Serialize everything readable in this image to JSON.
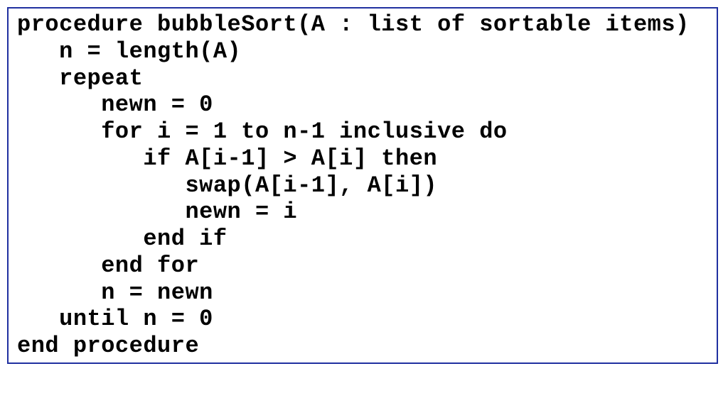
{
  "code": {
    "lines": [
      "procedure bubbleSort(A : list of sortable items)",
      "   n = length(A)",
      "   repeat",
      "      newn = 0",
      "      for i = 1 to n-1 inclusive do",
      "         if A[i-1] > A[i] then",
      "            swap(A[i-1], A[i])",
      "            newn = i",
      "         end if",
      "      end for",
      "      n = newn",
      "   until n = 0",
      "end procedure"
    ]
  },
  "colors": {
    "border": "#2030a0",
    "text": "#000000",
    "background": "#ffffff"
  }
}
